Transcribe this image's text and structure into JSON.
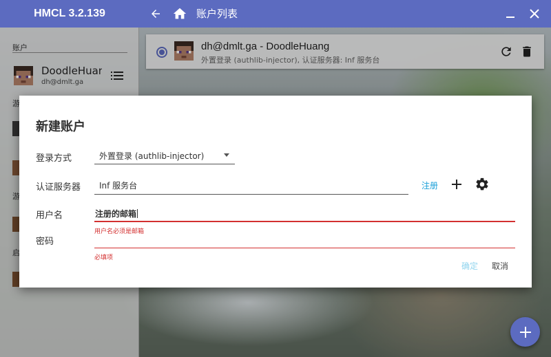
{
  "app": {
    "title": "HMCL 3.2.139"
  },
  "header": {
    "page_title": "账户列表",
    "back_icon": "arrow-left-icon",
    "home_icon": "home-icon",
    "minimize_icon": "minimize-icon",
    "close_icon": "close-icon"
  },
  "sidebar": {
    "account_heading": "账户",
    "account": {
      "name": "DoodleHuang",
      "email": "dh@dmlt.ga"
    },
    "partial_headings": [
      "游",
      "游",
      "启"
    ]
  },
  "account_card": {
    "title": "dh@dmlt.ga - DoodleHuang",
    "subtitle": "外置登录 (authlib-injector), 认证服务器: Inf 服务台",
    "selected": true
  },
  "dialog": {
    "title": "新建账户",
    "login_method": {
      "label": "登录方式",
      "value": "外置登录 (authlib-injector)"
    },
    "auth_server": {
      "label": "认证服务器",
      "value": "Inf 服务台",
      "register_link": "注册"
    },
    "username": {
      "label": "用户名",
      "value": "注册的邮箱",
      "error": "用户名必须是邮箱"
    },
    "password": {
      "label": "密码",
      "value": "",
      "error": "必填项"
    },
    "buttons": {
      "ok": "确定",
      "cancel": "取消"
    }
  },
  "colors": {
    "accent": "#5c6bc0",
    "error": "#d32f2f",
    "link": "#1a9fd8",
    "ok_disabled": "#90d4ee"
  }
}
